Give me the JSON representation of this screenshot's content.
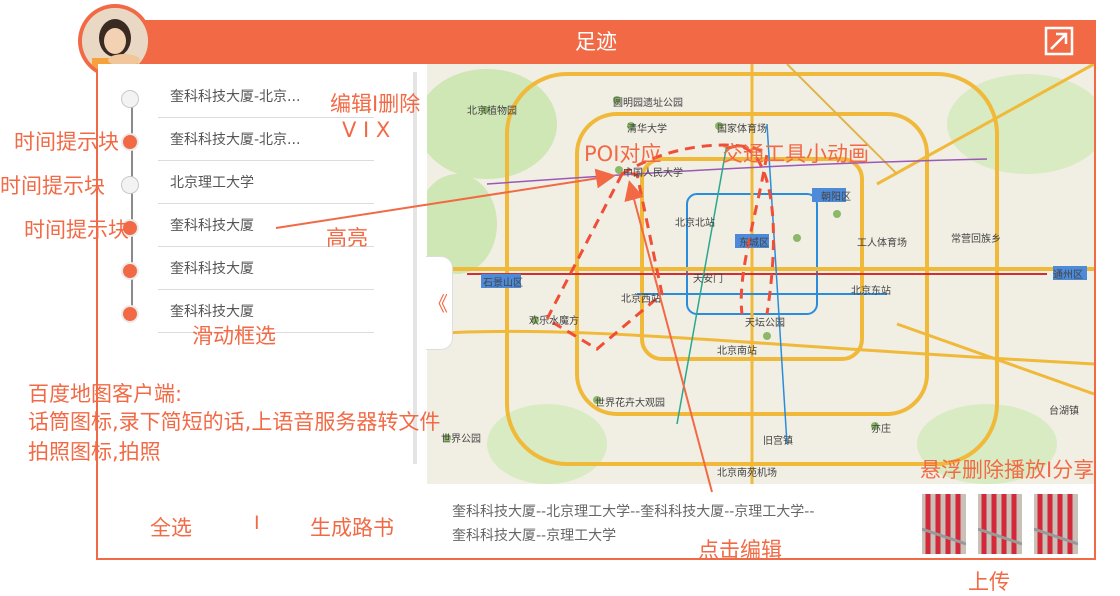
{
  "app": {
    "title": "足迹"
  },
  "timeline": [
    {
      "label": "奎科科技大厦-北京...",
      "active": false
    },
    {
      "label": "奎科科技大厦-北京...",
      "active": true
    },
    {
      "label": "北京理工大学",
      "active": false
    },
    {
      "label": "奎科科技大厦",
      "active": true
    },
    {
      "label": "奎科科技大厦",
      "active": true
    },
    {
      "label": "奎科科技大厦",
      "active": true
    }
  ],
  "footer": {
    "select_all": "全选",
    "separator": "I",
    "generate": "生成路书"
  },
  "collapse_glyph": "《",
  "route": {
    "line1": "奎科科技大厦--北京理工大学--奎科科技大厦--京理工大学--",
    "line2": "奎科科技大厦--京理工大学"
  },
  "map_labels": [
    {
      "text": "北京植物园"
    },
    {
      "text": "圆明园遗址公园"
    },
    {
      "text": "清华大学"
    },
    {
      "text": "国家体育场"
    },
    {
      "text": "中国人民大学"
    },
    {
      "text": "北京北站"
    },
    {
      "text": "天安门"
    },
    {
      "text": "北京西站"
    },
    {
      "text": "北京南站"
    },
    {
      "text": "北京东站"
    },
    {
      "text": "天坛公园"
    },
    {
      "text": "欢乐水魔方"
    },
    {
      "text": "世界公园"
    },
    {
      "text": "世界花卉大观园"
    },
    {
      "text": "旧宫镇"
    },
    {
      "text": "亦庄"
    },
    {
      "text": "北京南苑机场"
    },
    {
      "text": "朝阳区"
    },
    {
      "text": "东城区"
    },
    {
      "text": "石景山区"
    },
    {
      "text": "通州区"
    },
    {
      "text": "工人体育场"
    },
    {
      "text": "常营回族乡"
    },
    {
      "text": "台湖镇"
    }
  ],
  "annotations": {
    "edit_delete": "编辑I删除",
    "v_i_x": "V  I  X",
    "time_tip_1": "时间提示块",
    "time_tip_2": "时间提示块",
    "time_tip_3": "时间提示块",
    "highlight": "高亮",
    "poi": "POI对应",
    "transport": "交通工具小动画",
    "slide_select": "滑动框选",
    "baidu_client": "百度地图客户端:",
    "voice_line": "话筒图标,录下简短的话,上语音服务器转文件",
    "photo_line": "拍照图标,拍照",
    "click_edit": "点击编辑",
    "hover_actions": "悬浮删除播放I分享",
    "upload": "上传"
  },
  "colors": {
    "accent": "#f26a45",
    "route": "#f04e36"
  }
}
